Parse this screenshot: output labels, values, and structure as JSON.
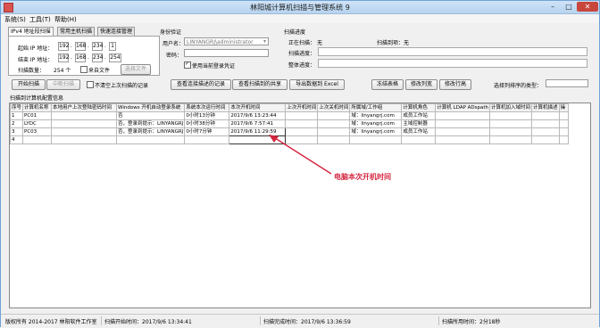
{
  "window": {
    "title": "林阳城计算机扫描与管理系统 9"
  },
  "menu": [
    "系统(S)",
    "工具(T)",
    "帮助(H)"
  ],
  "tabs": [
    "IPv4 地址段扫描",
    "常用主机扫描",
    "快速连接管理"
  ],
  "ip_panel": {
    "start_label": "起始 IP 地址：",
    "end_label": "结束 IP 地址：",
    "count_label": "扫描数量：",
    "count_value": "254 个",
    "from_file_label": "来自文件",
    "choose_file_button": "选择文件",
    "start_ip": [
      "192",
      "168",
      "234",
      "1"
    ],
    "end_ip": [
      "192",
      "168",
      "234",
      "254"
    ]
  },
  "auth": {
    "title": "身份验证",
    "user_label": "用户名：",
    "user_value": "LINYANGRJ\\administrator",
    "password_label": "密码：",
    "use_current_label": "使用当前登录凭证"
  },
  "progress": {
    "title": "扫描进度",
    "scanning_label": "正在扫描：",
    "scanning_value": "无",
    "scanned_label": "扫描到项：",
    "scanned_value": "无",
    "scan_label": "扫描进度：",
    "overall_label": "整体进度："
  },
  "toolbar": {
    "start": "开始扫描",
    "stop": "中断扫描",
    "noclear": "不清空上次扫描的记录",
    "view_users": "查看连接描述的记录",
    "view_shares": "查看扫描到的共享",
    "export": "导出数据到 Excel",
    "freeze": "冻结表格",
    "edit_col": "修改列宽",
    "edit_row": "修改行高",
    "sort_label": "选择列排序的类型："
  },
  "grid": {
    "title": "扫描到计算机配置信息",
    "columns": [
      "序号",
      "计算机名称",
      "本地用户上次登陆密码时间",
      "Windows 开机自动登录系统",
      "系统本次运行时间",
      "本次开机时间",
      "上次开机时间",
      "上次关机时间",
      "所属域/工作组",
      "计算机角色",
      "计算机 LDAP ADspath",
      "计算机加入域时间",
      "计算机描述",
      "操"
    ],
    "rows": [
      [
        "1",
        "PC01",
        "",
        "否",
        "0小时13分钟",
        "2017/9/6 13:23:44",
        "",
        "",
        "域：linyangrj.com",
        "成员工作站",
        "",
        "",
        "",
        ""
      ],
      [
        "2",
        "LYDC",
        "",
        "否，登录到提示：LINYANGRJ",
        "0小时38分钟",
        "2017/9/6 7:57:41",
        "",
        "",
        "域：linyangrj.com",
        "主域控制器",
        "",
        "",
        "",
        ""
      ],
      [
        "3",
        "PC03",
        "",
        "否，登录到提示：LINYANGRJ",
        "0小时7分钟",
        "2017/9/6 11:29:59",
        "",
        "",
        "域：linyangrj.com",
        "成员工作站",
        "",
        "",
        "",
        ""
      ],
      [
        "4",
        "",
        "",
        "",
        "",
        "",
        "",
        "",
        "",
        "",
        "",
        "",
        "",
        ""
      ]
    ]
  },
  "annotation": "电脑本次开机时间",
  "annotation_color": "#d4253f",
  "status": {
    "copyright": "版权所有 2014-2017 林阳软件工作室",
    "start_time": "扫描开始时间：2017/9/6 13:34:41",
    "end_time": "扫描完成时间：2017/9/6 13:36:59",
    "duration": "扫描所用时间：2分18秒"
  }
}
